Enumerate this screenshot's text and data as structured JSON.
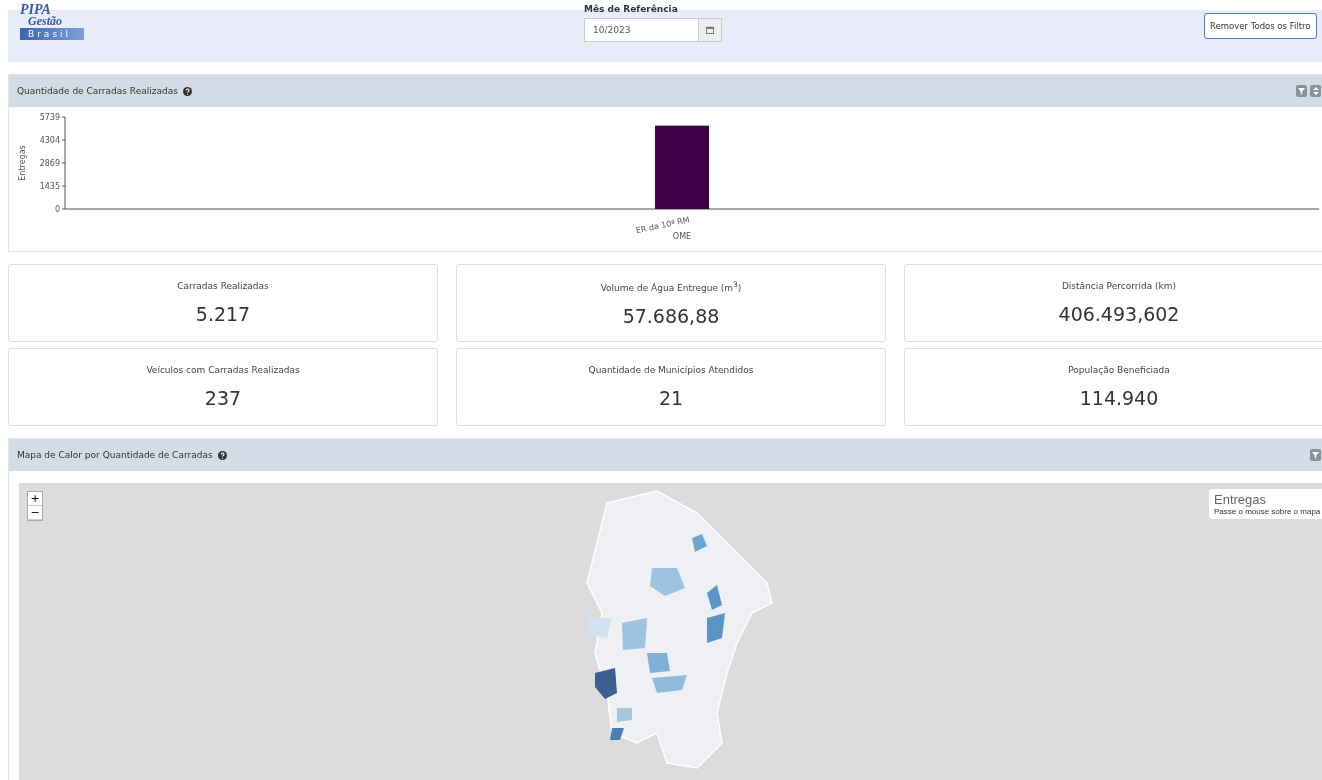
{
  "logo": {
    "line_1": "PIPA",
    "line_2": "Gestão",
    "line_3": "Brasil"
  },
  "reference_month": {
    "label": "Mês de Referência",
    "value": "10/2023"
  },
  "clear_filters_button": "Remover Todos os Filtro",
  "deliveries_panel": {
    "title": "Quantidade de Carradas Realizadas",
    "chart_data": {
      "type": "bar",
      "xlabel": "OME",
      "ylabel": "Entregas",
      "categories": [
        "ER da 10ª RM"
      ],
      "values": [
        5200
      ],
      "ylim": [
        0,
        5739
      ],
      "yticks": [
        0,
        1435,
        2869,
        4304,
        5739
      ]
    }
  },
  "stats": [
    {
      "label": "Carradas Realizadas",
      "value": "5.217"
    },
    {
      "label": "Volume de Água Entregue (m$^{3}$)",
      "value": "57.686,88"
    },
    {
      "label": "Distância Percorrida (km)",
      "value": "406.493,602"
    },
    {
      "label": "Veículos com Carradas Realizadas",
      "value": "237"
    },
    {
      "label": "Quantidade de Municípios Atendidos",
      "value": "21"
    },
    {
      "label": "População Beneficiada",
      "value": "114.940"
    }
  ],
  "map_panel": {
    "title": "Mapa de Calor por Quantidade de Carradas",
    "zoom_in": "+",
    "zoom_out": "−",
    "legend": {
      "title": "Entregas",
      "hint": "Passe o mouse sobre o mapa"
    }
  }
}
